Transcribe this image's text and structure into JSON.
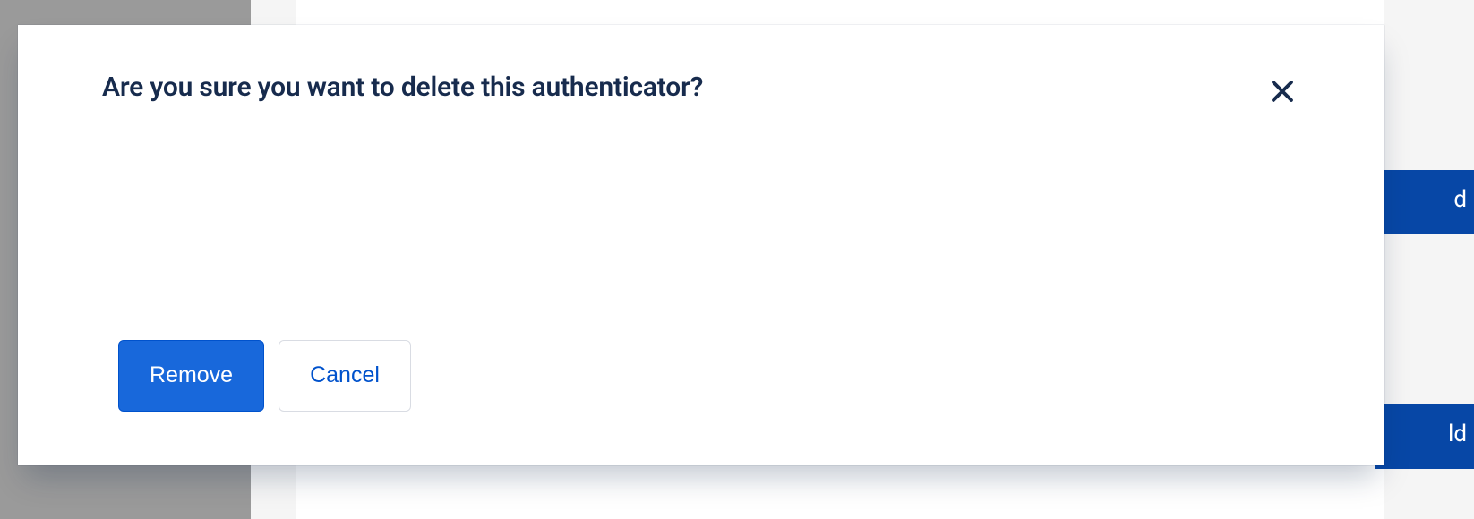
{
  "modal": {
    "title": "Are you sure you want to delete this authenticator?",
    "actions": {
      "primary_label": "Remove",
      "secondary_label": "Cancel"
    }
  }
}
